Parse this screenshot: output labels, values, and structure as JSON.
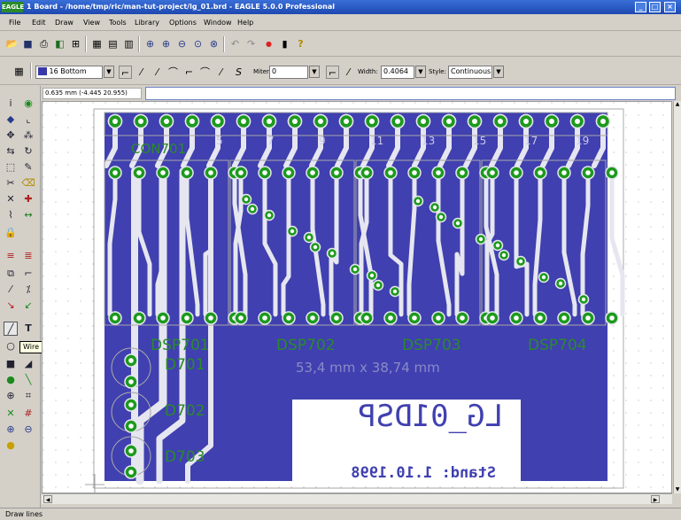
{
  "window": {
    "title": "1 Board - /home/tmp/ric/man-tut-project/lg_01.brd - EAGLE 5.0.0 Professional",
    "logo": "EAGLE",
    "controls": [
      "_",
      "□",
      "×"
    ]
  },
  "menu": [
    "File",
    "Edit",
    "Draw",
    "View",
    "Tools",
    "Library",
    "Options",
    "Window",
    "Help"
  ],
  "toolbar1": {
    "icons": [
      "open-icon",
      "save-icon",
      "print-icon",
      "cam-icon",
      "board-icon",
      "script-icon",
      "ulp-icon",
      "ulp2-icon",
      "zoom-fit-icon",
      "zoom-in-icon",
      "zoom-out-icon",
      "zoom-redraw-icon",
      "zoom-select-icon",
      "undo-icon",
      "redo-icon",
      "stop-icon",
      "drc-icon",
      "help-icon"
    ]
  },
  "toolbar2": {
    "layer_value": "16 Bottom",
    "layer_color": "#3838a8",
    "miter_label": "Miter:",
    "miter_value": "0",
    "width_label": "Width:",
    "width_value": "0.4064",
    "style_label": "Style:",
    "style_value": "Continuous"
  },
  "coordinates": "0.635 mm (-4.445 20.955)",
  "command_value": "",
  "status_text": "Draw lines",
  "tooltip": "Wire",
  "colors": {
    "board_fill": "#4040b0",
    "pad_green": "#1c9a1c",
    "trace_white": "#e6e6f0",
    "text_green": "#2a8a2a",
    "frame_grey": "#a8a8a8"
  },
  "board": {
    "connector_label": "CON701",
    "pin_numbers": [
      "5",
      "7",
      "9",
      "11",
      "13",
      "15",
      "17",
      "19"
    ],
    "displays": [
      "DSP701",
      "DSP702",
      "DSP703",
      "DSP704"
    ],
    "leds": [
      "D701",
      "D702",
      "D703"
    ],
    "dimension_text": "53,4 mm x 38,74 mm",
    "mirrored_text1": "LG_01DSP",
    "mirrored_text2": "Stand: 1.10.1998"
  }
}
